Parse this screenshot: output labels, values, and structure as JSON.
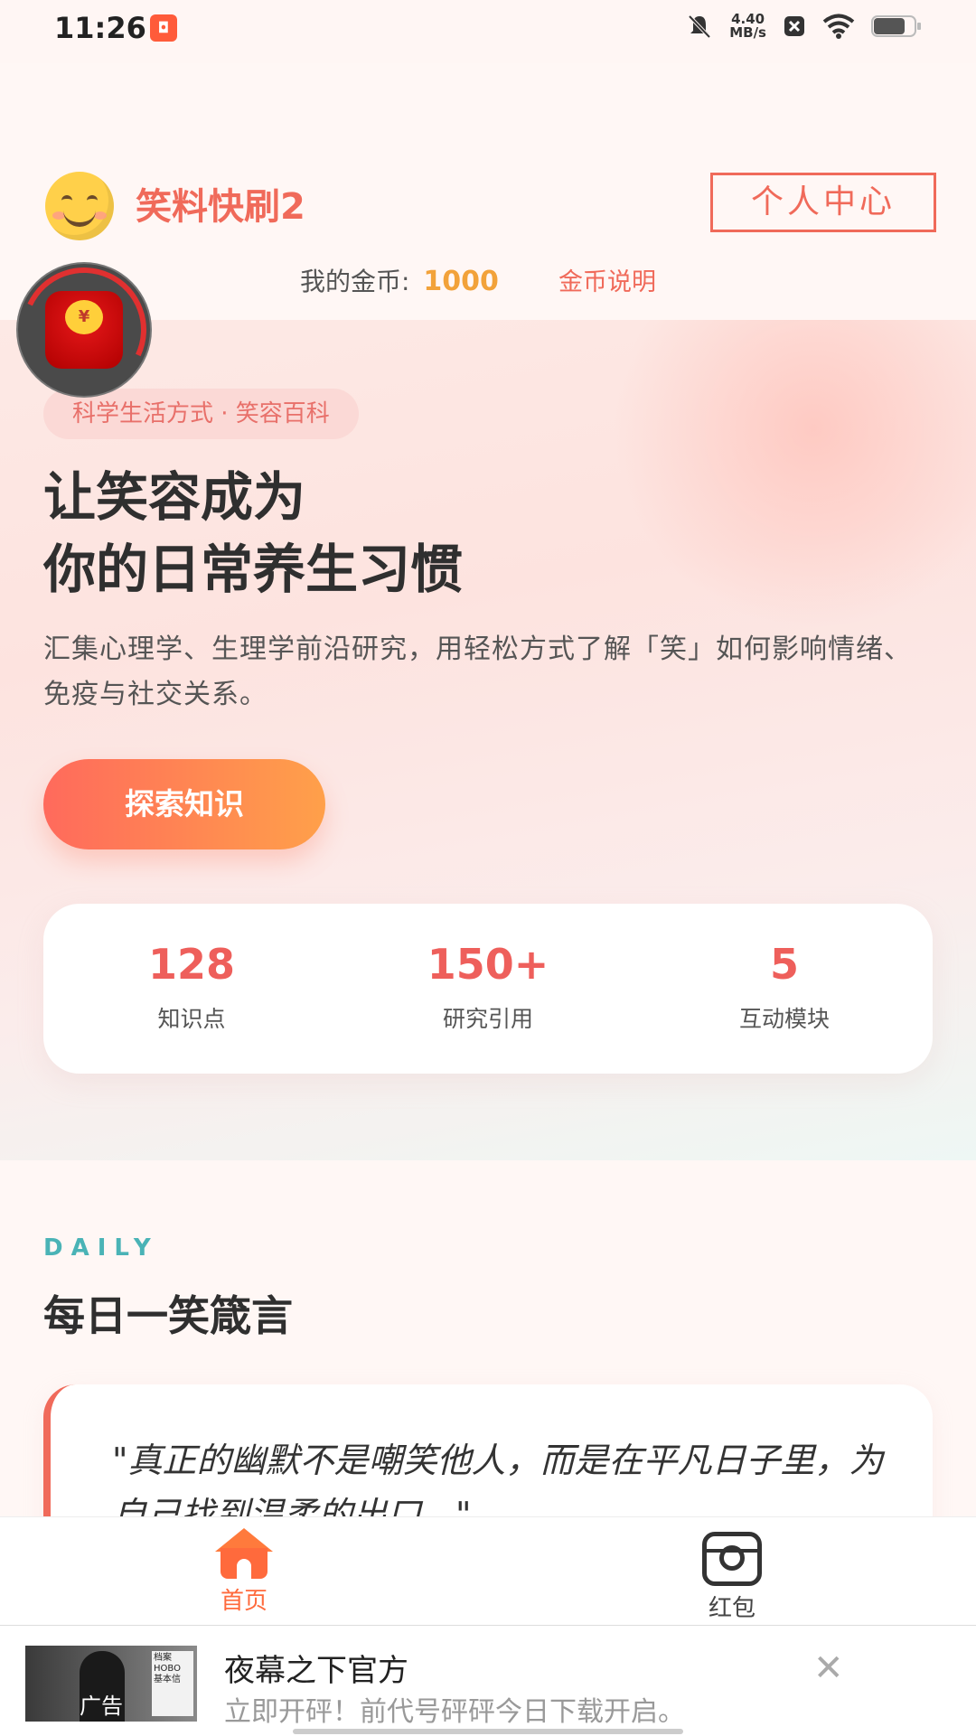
{
  "status_bar": {
    "time": "11:26",
    "net_speed_top": "4.40",
    "net_speed_bottom": "MB/s"
  },
  "header": {
    "app_title": "笑料快刷2",
    "profile_button": "个人中心",
    "coins_label": "我的金币:",
    "coins_value": "1000",
    "coins_help": "金币说明"
  },
  "hero": {
    "tag": "科学生活方式 · 笑容百科",
    "headline_line1": "让笑容成为",
    "headline_line2": "你的日常养生习惯",
    "description": "汇集心理学、生理学前沿研究，用轻松方式了解「笑」如何影响情绪、免疫与社交关系。",
    "explore_button": "探索知识",
    "stats": [
      {
        "value": "128",
        "label": "知识点"
      },
      {
        "value": "150+",
        "label": "研究引用"
      },
      {
        "value": "5",
        "label": "互动模块"
      }
    ]
  },
  "daily": {
    "label": "DAILY",
    "title": "每日一笑箴言",
    "quote": "\"真正的幽默不是嘲笑他人，而是在平凡日子里，为自己找到温柔的出口。\""
  },
  "bottom_nav": {
    "items": [
      {
        "label": "首页",
        "icon": "home-icon",
        "active": true
      },
      {
        "label": "红包",
        "icon": "camera-icon",
        "active": false
      }
    ]
  },
  "ad": {
    "tag": "广告",
    "title": "夜幕之下官方",
    "subtitle": "立即开砰！前代号砰砰今日下载开启。",
    "thumb_text": "档案 HOBO 基本信"
  },
  "colors": {
    "accent": "#f06a5a",
    "coin": "#f2a23a",
    "teal": "#4ab3b6",
    "active_nav": "#ff6a3c"
  }
}
